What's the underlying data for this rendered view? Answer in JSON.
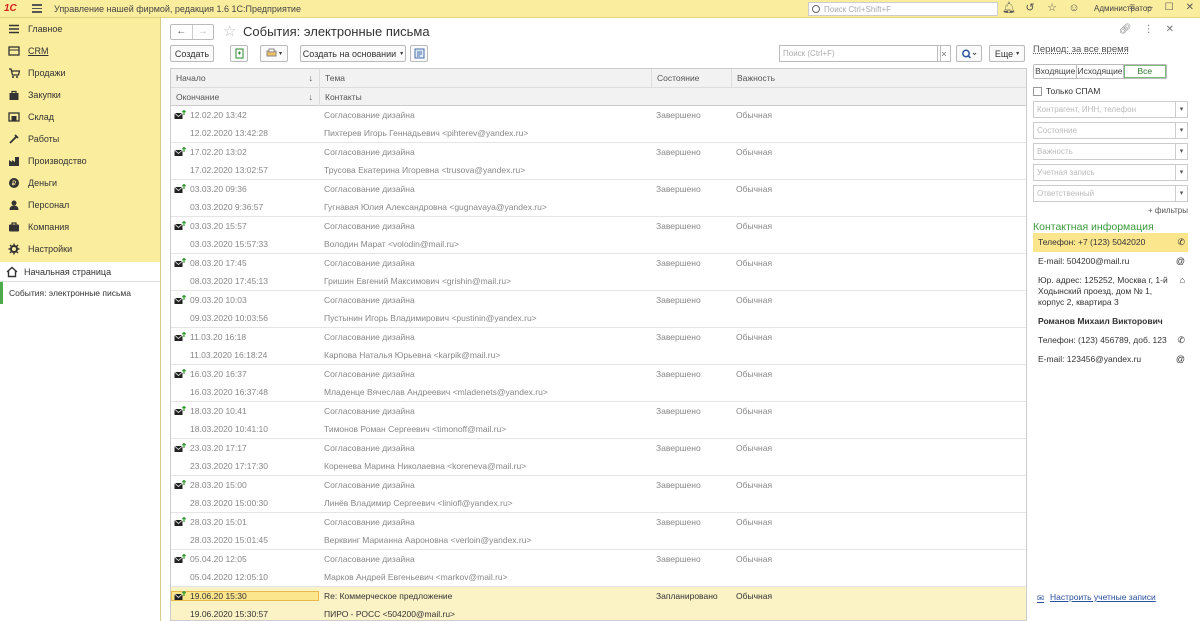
{
  "app": {
    "title": "Управление нашей фирмой, редакция 1.6 1С:Предприятие",
    "logo": "1С",
    "search_placeholder": "Поиск Ctrl+Shift+F",
    "user": "Администратор"
  },
  "sidebar": {
    "items": [
      {
        "label": "Главное",
        "icon": "menu-icon"
      },
      {
        "label": "CRM",
        "icon": "crm-icon"
      },
      {
        "label": "Продажи",
        "icon": "sales-icon"
      },
      {
        "label": "Закупки",
        "icon": "purchases-icon"
      },
      {
        "label": "Склад",
        "icon": "warehouse-icon"
      },
      {
        "label": "Работы",
        "icon": "works-icon"
      },
      {
        "label": "Производство",
        "icon": "production-icon"
      },
      {
        "label": "Деньги",
        "icon": "money-icon"
      },
      {
        "label": "Персонал",
        "icon": "staff-icon"
      },
      {
        "label": "Компания",
        "icon": "company-icon"
      },
      {
        "label": "Настройки",
        "icon": "settings-icon"
      }
    ],
    "home": "Начальная страница",
    "open_form": "События: электронные письма"
  },
  "form": {
    "title": "События: электронные письма",
    "create": "Создать",
    "create_based": "Создать на основании",
    "search_placeholder": "Поиск (Ctrl+F)",
    "more": "Еще"
  },
  "table": {
    "headers": {
      "start": "Начало",
      "subject": "Тема",
      "state": "Состояние",
      "importance": "Важность",
      "end": "Окончание",
      "contacts": "Контакты"
    },
    "rows": [
      {
        "start": "12.02.20 13:42",
        "end": "12.02.2020 13:42:28",
        "subject": "Согласование дизайна",
        "contact": "Пихтерев Игорь Геннадьевич <pihterev@yandex.ru>",
        "state": "Завершено",
        "importance": "Обычная"
      },
      {
        "start": "17.02.20 13:02",
        "end": "17.02.2020 13:02:57",
        "subject": "Согласование дизайна",
        "contact": "Трусова Екатерина Игоревна <trusova@yandex.ru>",
        "state": "Завершено",
        "importance": "Обычная"
      },
      {
        "start": "03.03.20 09:36",
        "end": "03.03.2020 9:36:57",
        "subject": "Согласование дизайна",
        "contact": "Гугнавая Юлия Александровна <gugnavaya@yandex.ru>",
        "state": "Завершено",
        "importance": "Обычная"
      },
      {
        "start": "03.03.20 15:57",
        "end": "03.03.2020 15:57:33",
        "subject": "Согласование дизайна",
        "contact": "Володин Марат <volodin@mail.ru>",
        "state": "Завершено",
        "importance": "Обычная"
      },
      {
        "start": "08.03.20 17:45",
        "end": "08.03.2020 17:45:13",
        "subject": "Согласование дизайна",
        "contact": "Гришин Евгений Максимович <grishin@mail.ru>",
        "state": "Завершено",
        "importance": "Обычная"
      },
      {
        "start": "09.03.20 10:03",
        "end": "09.03.2020 10:03:56",
        "subject": "Согласование дизайна",
        "contact": "Пустынин Игорь Владимирович <pustinin@yandex.ru>",
        "state": "Завершено",
        "importance": "Обычная"
      },
      {
        "start": "11.03.20 16:18",
        "end": "11.03.2020 16:18:24",
        "subject": "Согласование дизайна",
        "contact": "Карпова Наталья Юрьевна <karpik@mail.ru>",
        "state": "Завершено",
        "importance": "Обычная"
      },
      {
        "start": "16.03.20 16:37",
        "end": "16.03.2020 16:37:48",
        "subject": "Согласование дизайна",
        "contact": "Младенце Вячеслав Андреевич <mladenets@yandex.ru>",
        "state": "Завершено",
        "importance": "Обычная"
      },
      {
        "start": "18.03.20 10:41",
        "end": "18.03.2020 10:41:10",
        "subject": "Согласование дизайна",
        "contact": "Тимонов Роман Сергеевич <timonoff@mail.ru>",
        "state": "Завершено",
        "importance": "Обычная"
      },
      {
        "start": "23.03.20 17:17",
        "end": "23.03.2020 17:17:30",
        "subject": "Согласование дизайна",
        "contact": "Коренева Марина Николаевна <koreneva@mail.ru>",
        "state": "Завершено",
        "importance": "Обычная"
      },
      {
        "start": "28.03.20 15:00",
        "end": "28.03.2020 15:00:30",
        "subject": "Согласование дизайна",
        "contact": "Линёв Владимир Сергеевич <liniofl@yandex.ru>",
        "state": "Завершено",
        "importance": "Обычная"
      },
      {
        "start": "28.03.20 15:01",
        "end": "28.03.2020 15:01:45",
        "subject": "Согласование дизайна",
        "contact": "Верквинг Марианна Аароновна <verloin@yandex.ru>",
        "state": "Завершено",
        "importance": "Обычная"
      },
      {
        "start": "05.04.20 12:05",
        "end": "05.04.2020 12:05:10",
        "subject": "Согласование дизайна",
        "contact": "Марков Андрей Евгеньевич <markov@mail.ru>",
        "state": "Завершено",
        "importance": "Обычная"
      },
      {
        "start": "19.06.20 15:30",
        "end": "19.06.2020 15:30:57",
        "subject": "Re: Коммерческое предложение",
        "contact": "ПИРО - РОСС <504200@mail.ru>",
        "state": "Запланировано",
        "importance": "Обычная",
        "selected": true
      }
    ]
  },
  "filters": {
    "period": "Период: за все время",
    "segments": [
      "Входящие",
      "Исходящие",
      "Все"
    ],
    "active_segment": "Все",
    "spam": "Только СПАМ",
    "fields": [
      "Контрагент, ИНН, телефон",
      "Состояние",
      "Важность",
      "Учетная запись",
      "Ответственный"
    ],
    "more_filters": "+ фильтры"
  },
  "contact_info": {
    "title": "Контактная информация",
    "phone": "Телефон: +7 (123) 5042020",
    "email": "E-mail: 504200@mail.ru",
    "address": "Юр. адрес: 125252, Москва г, 1-й Ходынский проезд, дом № 1, корпус 2, квартира 3",
    "person": "Романов Михаил Викторович",
    "person_phone": "Телефон: (123) 456789, доб. 123",
    "person_email": "E-mail: 123456@yandex.ru"
  },
  "setup_link": "Настроить учетные записи"
}
